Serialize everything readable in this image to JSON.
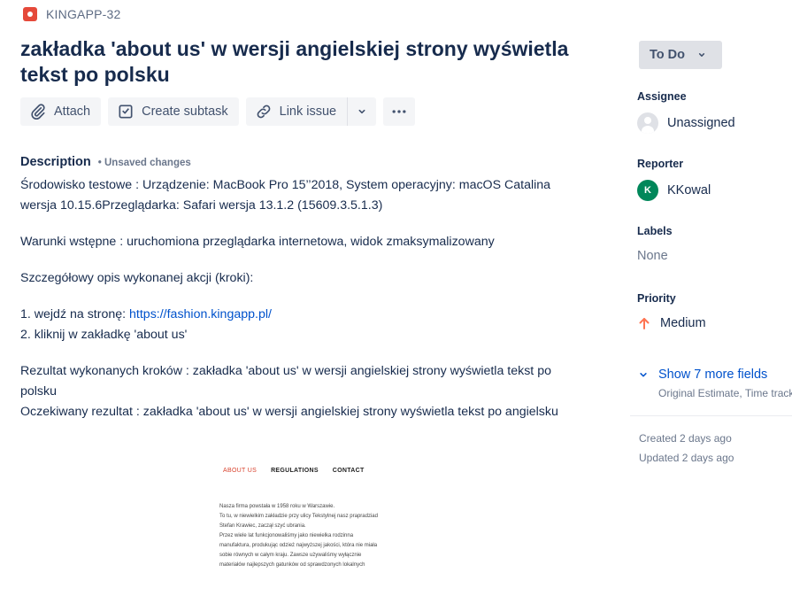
{
  "issue": {
    "key": "KINGAPP-32",
    "type_icon": "bug-icon",
    "title": "zakładka 'about us' w wersji angielskiej strony wyświetla tekst po polsku"
  },
  "toolbar": {
    "attach_label": "Attach",
    "create_subtask_label": "Create subtask",
    "link_issue_label": "Link issue"
  },
  "description": {
    "label": "Description",
    "unsaved": "• Unsaved changes",
    "env_line": "Środowisko testowe : Urządzenie: MacBook Pro 15’’2018, System operacyjny: macOS Catalina wersja 10.15.6Przeglądarka: Safari wersja 13.1.2 (15609.3.5.1.3)",
    "preconditions": "Warunki wstępne : uruchomiona przeglądarka internetowa, widok zmaksymalizowany",
    "steps_heading": "Szczegółowy opis wykonanej akcji (kroki):",
    "step1_prefix": "1. wejdź na stronę: ",
    "step1_link": "https://fashion.kingapp.pl/",
    "step2": "2. kliknij w zakładkę 'about us'",
    "result": "Rezultat wykonanych kroków : zakładka 'about us' w wersji angielskiej strony wyświetla tekst po polsku",
    "expected": "Oczekiwany rezultat : zakładka 'about us' w wersji angielskiej strony wyświetla tekst po angielsku"
  },
  "embedded_screenshot": {
    "nav": [
      "ABOUT US",
      "REGULATIONS",
      "CONTACT"
    ],
    "active_color": "#d9442f",
    "lines": [
      "Nasza firma powstała w 1958 roku w Warszawie.",
      "To tu, w niewielkim zakładzie przy ulicy Tekstylnej nasz prapradziad",
      "Stefan Krawiec, zaczął szyć ubrania.",
      "Przez wiele lat funkcjonowaliśmy jako niewielka rodzinna",
      "manufaktura, produkując odzież najwyższej jakości, która nie miała",
      "sobie równych w całym kraju. Zawsze używaliśmy wyłącznie",
      "materiałów najlepszych gatunków od sprawdzonych lokalnych"
    ]
  },
  "sidebar": {
    "status": "To Do",
    "assignee_label": "Assignee",
    "assignee_value": "Unassigned",
    "reporter_label": "Reporter",
    "reporter_initial": "K",
    "reporter_value": "KKowal",
    "labels_label": "Labels",
    "labels_value": "None",
    "priority_label": "Priority",
    "priority_value": "Medium",
    "priority_color": "#ff7452",
    "more_fields": "Show 7 more fields",
    "more_fields_sub": "Original Estimate, Time tracking",
    "created": "Created 2 days ago",
    "updated": "Updated 2 days ago"
  }
}
